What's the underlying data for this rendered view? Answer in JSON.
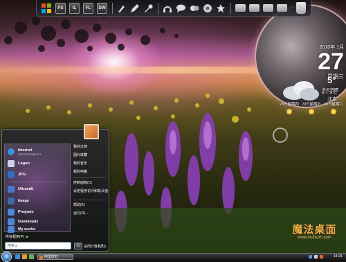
{
  "dock": {
    "icons": [
      {
        "name": "windows-icon",
        "text": ""
      },
      {
        "name": "photoshop-icon",
        "text": "PS"
      },
      {
        "name": "illustrator-icon",
        "text": "IL"
      },
      {
        "name": "flash-icon",
        "text": "FL"
      },
      {
        "name": "dreamweaver-icon",
        "text": "DW"
      },
      {
        "name": "brush-icon",
        "text": ""
      },
      {
        "name": "pen-icon",
        "text": ""
      },
      {
        "name": "wrench-icon",
        "text": ""
      },
      {
        "name": "headphones-icon",
        "text": ""
      },
      {
        "name": "chat-icon",
        "text": ""
      },
      {
        "name": "messenger-icon",
        "text": ""
      },
      {
        "name": "chrome-icon",
        "text": ""
      },
      {
        "name": "star-icon",
        "text": ""
      },
      {
        "name": "folder-icon",
        "text": ""
      },
      {
        "name": "folder-icon",
        "text": ""
      },
      {
        "name": "folder-icon",
        "text": ""
      },
      {
        "name": "folder-icon",
        "text": ""
      },
      {
        "name": "recycle-bin-icon",
        "text": ""
      }
    ]
  },
  "clock": {
    "date_line": "2010年 1月",
    "day": "27",
    "weekday": "星期三"
  },
  "weather": {
    "temperature": "5°",
    "condition": "多云转晴",
    "range": "5 ~ -5°C",
    "city": "北京",
    "forecast": [
      {
        "label": "28日星期四"
      },
      {
        "label": "29日星期五"
      },
      {
        "label": "30日星期六"
      }
    ]
  },
  "start_menu": {
    "pinned": [
      {
        "label": "Internet",
        "sub": "Internet Explorer",
        "icon": "ie-icon",
        "color": "#3f8fe0"
      },
      {
        "label": "Logon",
        "sub": "",
        "icon": "logon-icon",
        "color": "#c9d4e6"
      },
      {
        "label": "JPG",
        "sub": "",
        "icon": "image-icon",
        "color": "#2f6fc2"
      }
    ],
    "recent": [
      {
        "label": "Ultraedit",
        "icon": "ultraedit-icon",
        "color": "#4477cc"
      },
      {
        "label": "Image",
        "icon": "image-icon",
        "color": "#3a6bb0"
      },
      {
        "label": "Program",
        "icon": "folder-icon",
        "color": "#4a8ad8"
      },
      {
        "label": "Downloads",
        "icon": "folder-icon",
        "color": "#4a8ad8"
      },
      {
        "label": "My works",
        "icon": "folder-icon",
        "color": "#4a8ad8"
      }
    ],
    "all_programs": "所有程序(P)",
    "search_placeholder": "搜索 ρ",
    "right_items": [
      "我的文档",
      "图片收藏",
      "我的音乐",
      "我的电脑",
      "控制面板(C)",
      "设定程序访问和默认值",
      "帮助(E)",
      "运行(R)..."
    ],
    "shutdown_label": "关闭计算机(U)"
  },
  "taskbar": {
    "task_button_label": "阿里旺旺",
    "time": "14:24"
  },
  "watermark": {
    "title": "魔法桌面",
    "url": "www.mofazm.com"
  },
  "colors": {
    "accent": "#3f8fe0",
    "watermark": "#e8b04a"
  }
}
